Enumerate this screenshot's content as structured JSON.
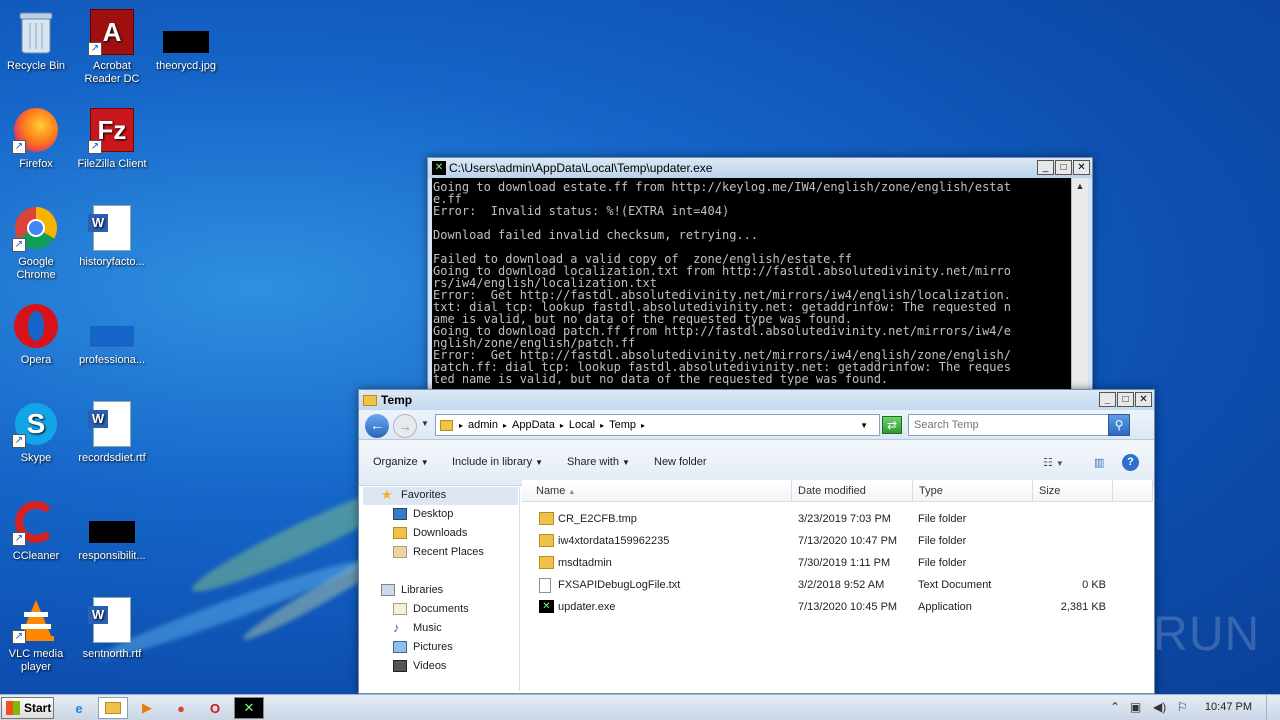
{
  "desktop": {
    "icons": [
      {
        "label": "Recycle Bin",
        "icon": "recycle-bin-icon"
      },
      {
        "label": "Acrobat Reader DC",
        "icon": "acrobat-icon"
      },
      {
        "label": "theorycd.jpg",
        "icon": "image-file-icon"
      },
      {
        "label": "Firefox",
        "icon": "firefox-icon"
      },
      {
        "label": "FileZilla Client",
        "icon": "filezilla-icon"
      },
      {
        "label": "Google Chrome",
        "icon": "chrome-icon"
      },
      {
        "label": "historyfacto...",
        "icon": "word-doc-icon"
      },
      {
        "label": "Opera",
        "icon": "opera-icon"
      },
      {
        "label": "professiona...",
        "icon": "file-icon"
      },
      {
        "label": "Skype",
        "icon": "skype-icon"
      },
      {
        "label": "recordsdiet.rtf",
        "icon": "word-doc-icon"
      },
      {
        "label": "CCleaner",
        "icon": "ccleaner-icon"
      },
      {
        "label": "responsibilit...",
        "icon": "image-file-icon"
      },
      {
        "label": "VLC media player",
        "icon": "vlc-icon"
      },
      {
        "label": "sentnorth.rtf",
        "icon": "word-doc-icon"
      }
    ]
  },
  "console": {
    "title": "C:\\Users\\admin\\AppData\\Local\\Temp\\updater.exe",
    "text": "Going to download estate.ff from http://keylog.me/IW4/english/zone/english/estat\ne.ff\nError:  Invalid status: %!(EXTRA int=404)\n\nDownload failed invalid checksum, retrying...\n\nFailed to download a valid copy of  zone/english/estate.ff\nGoing to download localization.txt from http://fastdl.absolutedivinity.net/mirro\nrs/iw4/english/localization.txt\nError:  Get http://fastdl.absolutedivinity.net/mirrors/iw4/english/localization.\ntxt: dial tcp: lookup fastdl.absolutedivinity.net: getaddrinfow: The requested n\name is valid, but no data of the requested type was found.\nGoing to download patch.ff from http://fastdl.absolutedivinity.net/mirrors/iw4/e\nnglish/zone/english/patch.ff\nError:  Get http://fastdl.absolutedivinity.net/mirrors/iw4/english/zone/english/\npatch.ff: dial tcp: lookup fastdl.absolutedivinity.net: getaddrinfow: The reques\nted name is valid, but no data of the requested type was found."
  },
  "explorer": {
    "title": "Temp",
    "breadcrumb": [
      "admin",
      "AppData",
      "Local",
      "Temp"
    ],
    "search_placeholder": "Search Temp",
    "commands": {
      "organize": "Organize",
      "include": "Include in library",
      "share": "Share with",
      "new_folder": "New folder"
    },
    "nav": {
      "favorites": "Favorites",
      "desktop": "Desktop",
      "downloads": "Downloads",
      "recent": "Recent Places",
      "libraries": "Libraries",
      "documents": "Documents",
      "music": "Music",
      "pictures": "Pictures",
      "videos": "Videos"
    },
    "columns": {
      "name": "Name",
      "date": "Date modified",
      "type": "Type",
      "size": "Size"
    },
    "files": [
      {
        "name": "CR_E2CFB.tmp",
        "date": "3/23/2019 7:03 PM",
        "type": "File folder",
        "size": "",
        "icon": "folder-icon"
      },
      {
        "name": "iw4xtordata159962235",
        "date": "7/13/2020 10:47 PM",
        "type": "File folder",
        "size": "",
        "icon": "folder-icon"
      },
      {
        "name": "msdtadmin",
        "date": "7/30/2019 1:11 PM",
        "type": "File folder",
        "size": "",
        "icon": "folder-icon"
      },
      {
        "name": "FXSAPIDebugLogFile.txt",
        "date": "3/2/2018 9:52 AM",
        "type": "Text Document",
        "size": "0 KB",
        "icon": "text-file-icon"
      },
      {
        "name": "updater.exe",
        "date": "7/13/2020 10:45 PM",
        "type": "Application",
        "size": "2,381 KB",
        "icon": "app-icon"
      }
    ]
  },
  "taskbar": {
    "start": "Start",
    "clock": "10:47 PM"
  },
  "watermark": "ANY RUN"
}
